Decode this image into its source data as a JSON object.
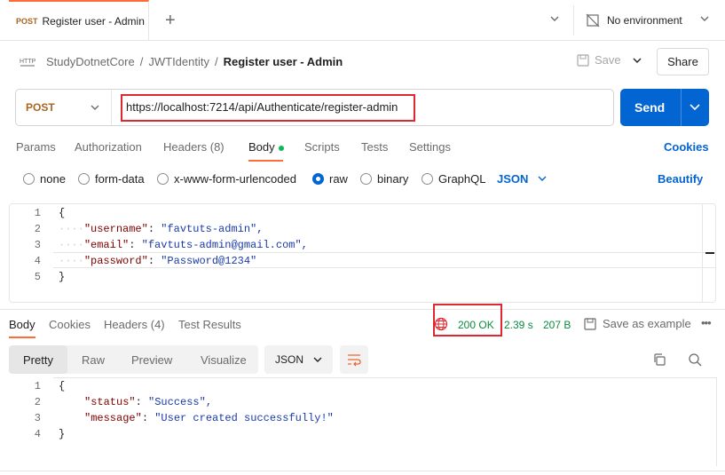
{
  "tab": {
    "method": "POST",
    "title": "Register user - Admin",
    "new_tab_icon": "plus-icon",
    "environment": "No environment"
  },
  "breadcrumb": {
    "items": [
      "StudyDotnetCore",
      "/",
      "JWTIdentity",
      "/",
      "Register user - Admin"
    ],
    "save_label": "Save",
    "share_label": "Share"
  },
  "request": {
    "method": "POST",
    "url": "https://localhost:7214/api/Authenticate/register-admin",
    "send_label": "Send",
    "tabs": [
      "Params",
      "Authorization",
      "Headers (8)",
      "Body",
      "Scripts",
      "Tests",
      "Settings"
    ],
    "active_tab": "Body",
    "cookies_label": "Cookies",
    "body_modes": [
      "none",
      "form-data",
      "x-www-form-urlencoded",
      "raw",
      "binary",
      "GraphQL"
    ],
    "selected_mode": "raw",
    "format": "JSON",
    "beautify_label": "Beautify",
    "line_numbers": [
      "1",
      "2",
      "3",
      "4",
      "5"
    ],
    "body_lines": [
      {
        "key": "",
        "value": "",
        "text": "{"
      },
      {
        "key": "\"username\"",
        "value": "\"favtuts-admin\","
      },
      {
        "key": "\"email\"",
        "value": "\"favtuts-admin@gmail.com\","
      },
      {
        "key": "\"password\"",
        "value": "\"Password@1234\""
      },
      {
        "key": "",
        "value": "",
        "text": "}"
      }
    ]
  },
  "response": {
    "tabs": [
      "Body",
      "Cookies",
      "Headers (4)",
      "Test Results"
    ],
    "active_tab": "Body",
    "status": "200 OK",
    "time": "2.39 s",
    "size": "207 B",
    "save_example_label": "Save as example",
    "view_modes": [
      "Pretty",
      "Raw",
      "Preview",
      "Visualize"
    ],
    "active_view": "Pretty",
    "format": "JSON",
    "line_numbers": [
      "1",
      "2",
      "3",
      "4"
    ],
    "body_lines": [
      {
        "text": "{"
      },
      {
        "key": "\"status\"",
        "value": "\"Success\","
      },
      {
        "key": "\"message\"",
        "value": "\"User created successfully!\""
      },
      {
        "text": "}"
      }
    ]
  },
  "colors": {
    "accent_orange": "#ff6c37",
    "send_blue": "#0265d2",
    "method_post": "#a8651f",
    "status_green": "#0c8a3f",
    "highlight_red": "#e0262e"
  }
}
